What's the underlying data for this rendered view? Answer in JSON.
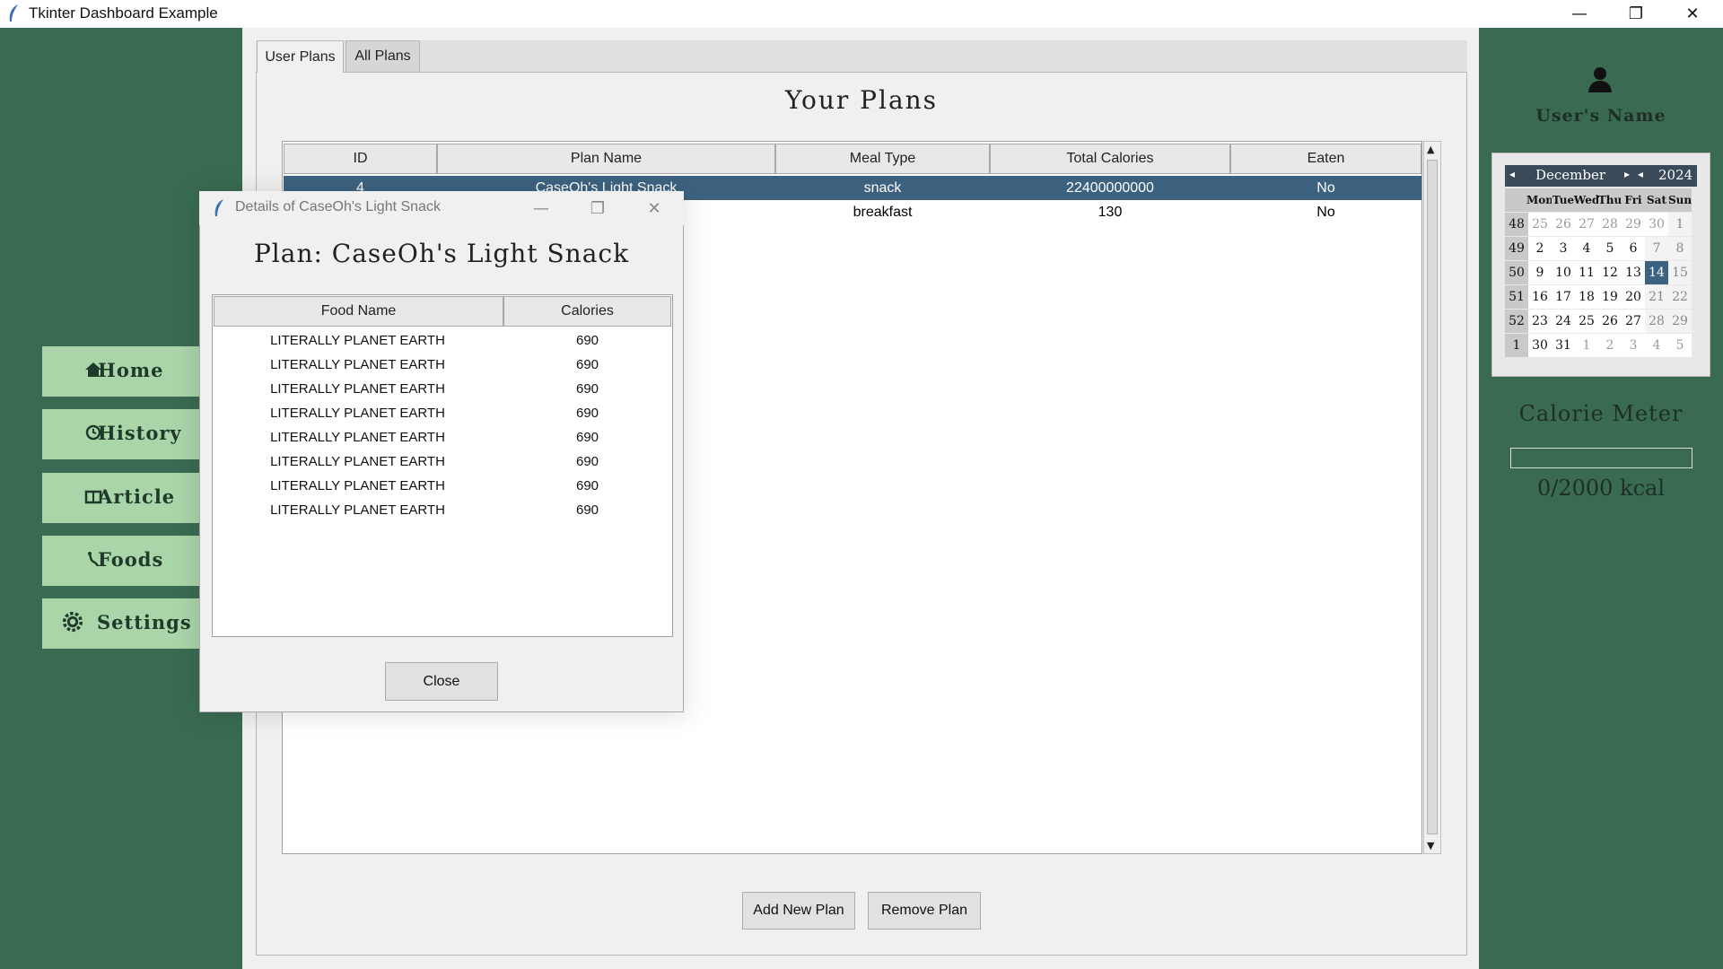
{
  "window": {
    "title": "Tkinter Dashboard Example",
    "minimize": "—",
    "maximize": "❐",
    "close": "✕"
  },
  "sidebar": {
    "items": [
      {
        "label": "Home",
        "icon": "home-icon"
      },
      {
        "label": "History",
        "icon": "clock-icon"
      },
      {
        "label": "Article",
        "icon": "book-icon"
      },
      {
        "label": "Foods",
        "icon": "food-icon"
      },
      {
        "label": "Settings",
        "icon": "gear-icon"
      }
    ]
  },
  "tabs": [
    {
      "label": "User Plans"
    },
    {
      "label": "All Plans"
    }
  ],
  "plans": {
    "title": "Your Plans",
    "columns": [
      "ID",
      "Plan Name",
      "Meal Type",
      "Total Calories",
      "Eaten"
    ],
    "rows": [
      {
        "id": "4",
        "name": "CaseOh's Light Snack",
        "meal": "snack",
        "calories": "22400000000",
        "eaten": "No",
        "selected": true
      },
      {
        "id": "",
        "name": "",
        "meal": "breakfast",
        "calories": "130",
        "eaten": "No",
        "selected": false
      }
    ],
    "add_label": "Add New Plan",
    "remove_label": "Remove Plan"
  },
  "right": {
    "user_name": "User's Name",
    "calendar": {
      "month": "December",
      "year": "2024",
      "headers": [
        "Mon",
        "Tue",
        "Wed",
        "Thu",
        "Fri",
        "Sat",
        "Sun"
      ],
      "weeks": [
        {
          "wk": "48",
          "days": [
            "25",
            "26",
            "27",
            "28",
            "29",
            "30",
            "1"
          ]
        },
        {
          "wk": "49",
          "days": [
            "2",
            "3",
            "4",
            "5",
            "6",
            "7",
            "8"
          ]
        },
        {
          "wk": "50",
          "days": [
            "9",
            "10",
            "11",
            "12",
            "13",
            "14",
            "15"
          ]
        },
        {
          "wk": "51",
          "days": [
            "16",
            "17",
            "18",
            "19",
            "20",
            "21",
            "22"
          ]
        },
        {
          "wk": "52",
          "days": [
            "23",
            "24",
            "25",
            "26",
            "27",
            "28",
            "29"
          ]
        },
        {
          "wk": "1",
          "days": [
            "30",
            "31",
            "1",
            "2",
            "3",
            "4",
            "5"
          ]
        }
      ],
      "selected_day": "14"
    },
    "meter_title": "Calorie Meter",
    "meter_text": "0/2000 kcal",
    "meter_fraction": 0
  },
  "dialog": {
    "title": "Details of CaseOh's Light Snack",
    "heading": "Plan: CaseOh's Light Snack",
    "columns": [
      "Food Name",
      "Calories"
    ],
    "rows": [
      {
        "food": "LITERALLY PLANET EARTH",
        "cal": "690"
      },
      {
        "food": "LITERALLY PLANET EARTH",
        "cal": "690"
      },
      {
        "food": "LITERALLY PLANET EARTH",
        "cal": "690"
      },
      {
        "food": "LITERALLY PLANET EARTH",
        "cal": "690"
      },
      {
        "food": "LITERALLY PLANET EARTH",
        "cal": "690"
      },
      {
        "food": "LITERALLY PLANET EARTH",
        "cal": "690"
      },
      {
        "food": "LITERALLY PLANET EARTH",
        "cal": "690"
      },
      {
        "food": "LITERALLY PLANET EARTH",
        "cal": "690"
      }
    ],
    "close_label": "Close"
  },
  "colors": {
    "sidebar_bg": "#3a6b52",
    "nav_button": "#a9d5a9",
    "selection": "#3d6280"
  }
}
